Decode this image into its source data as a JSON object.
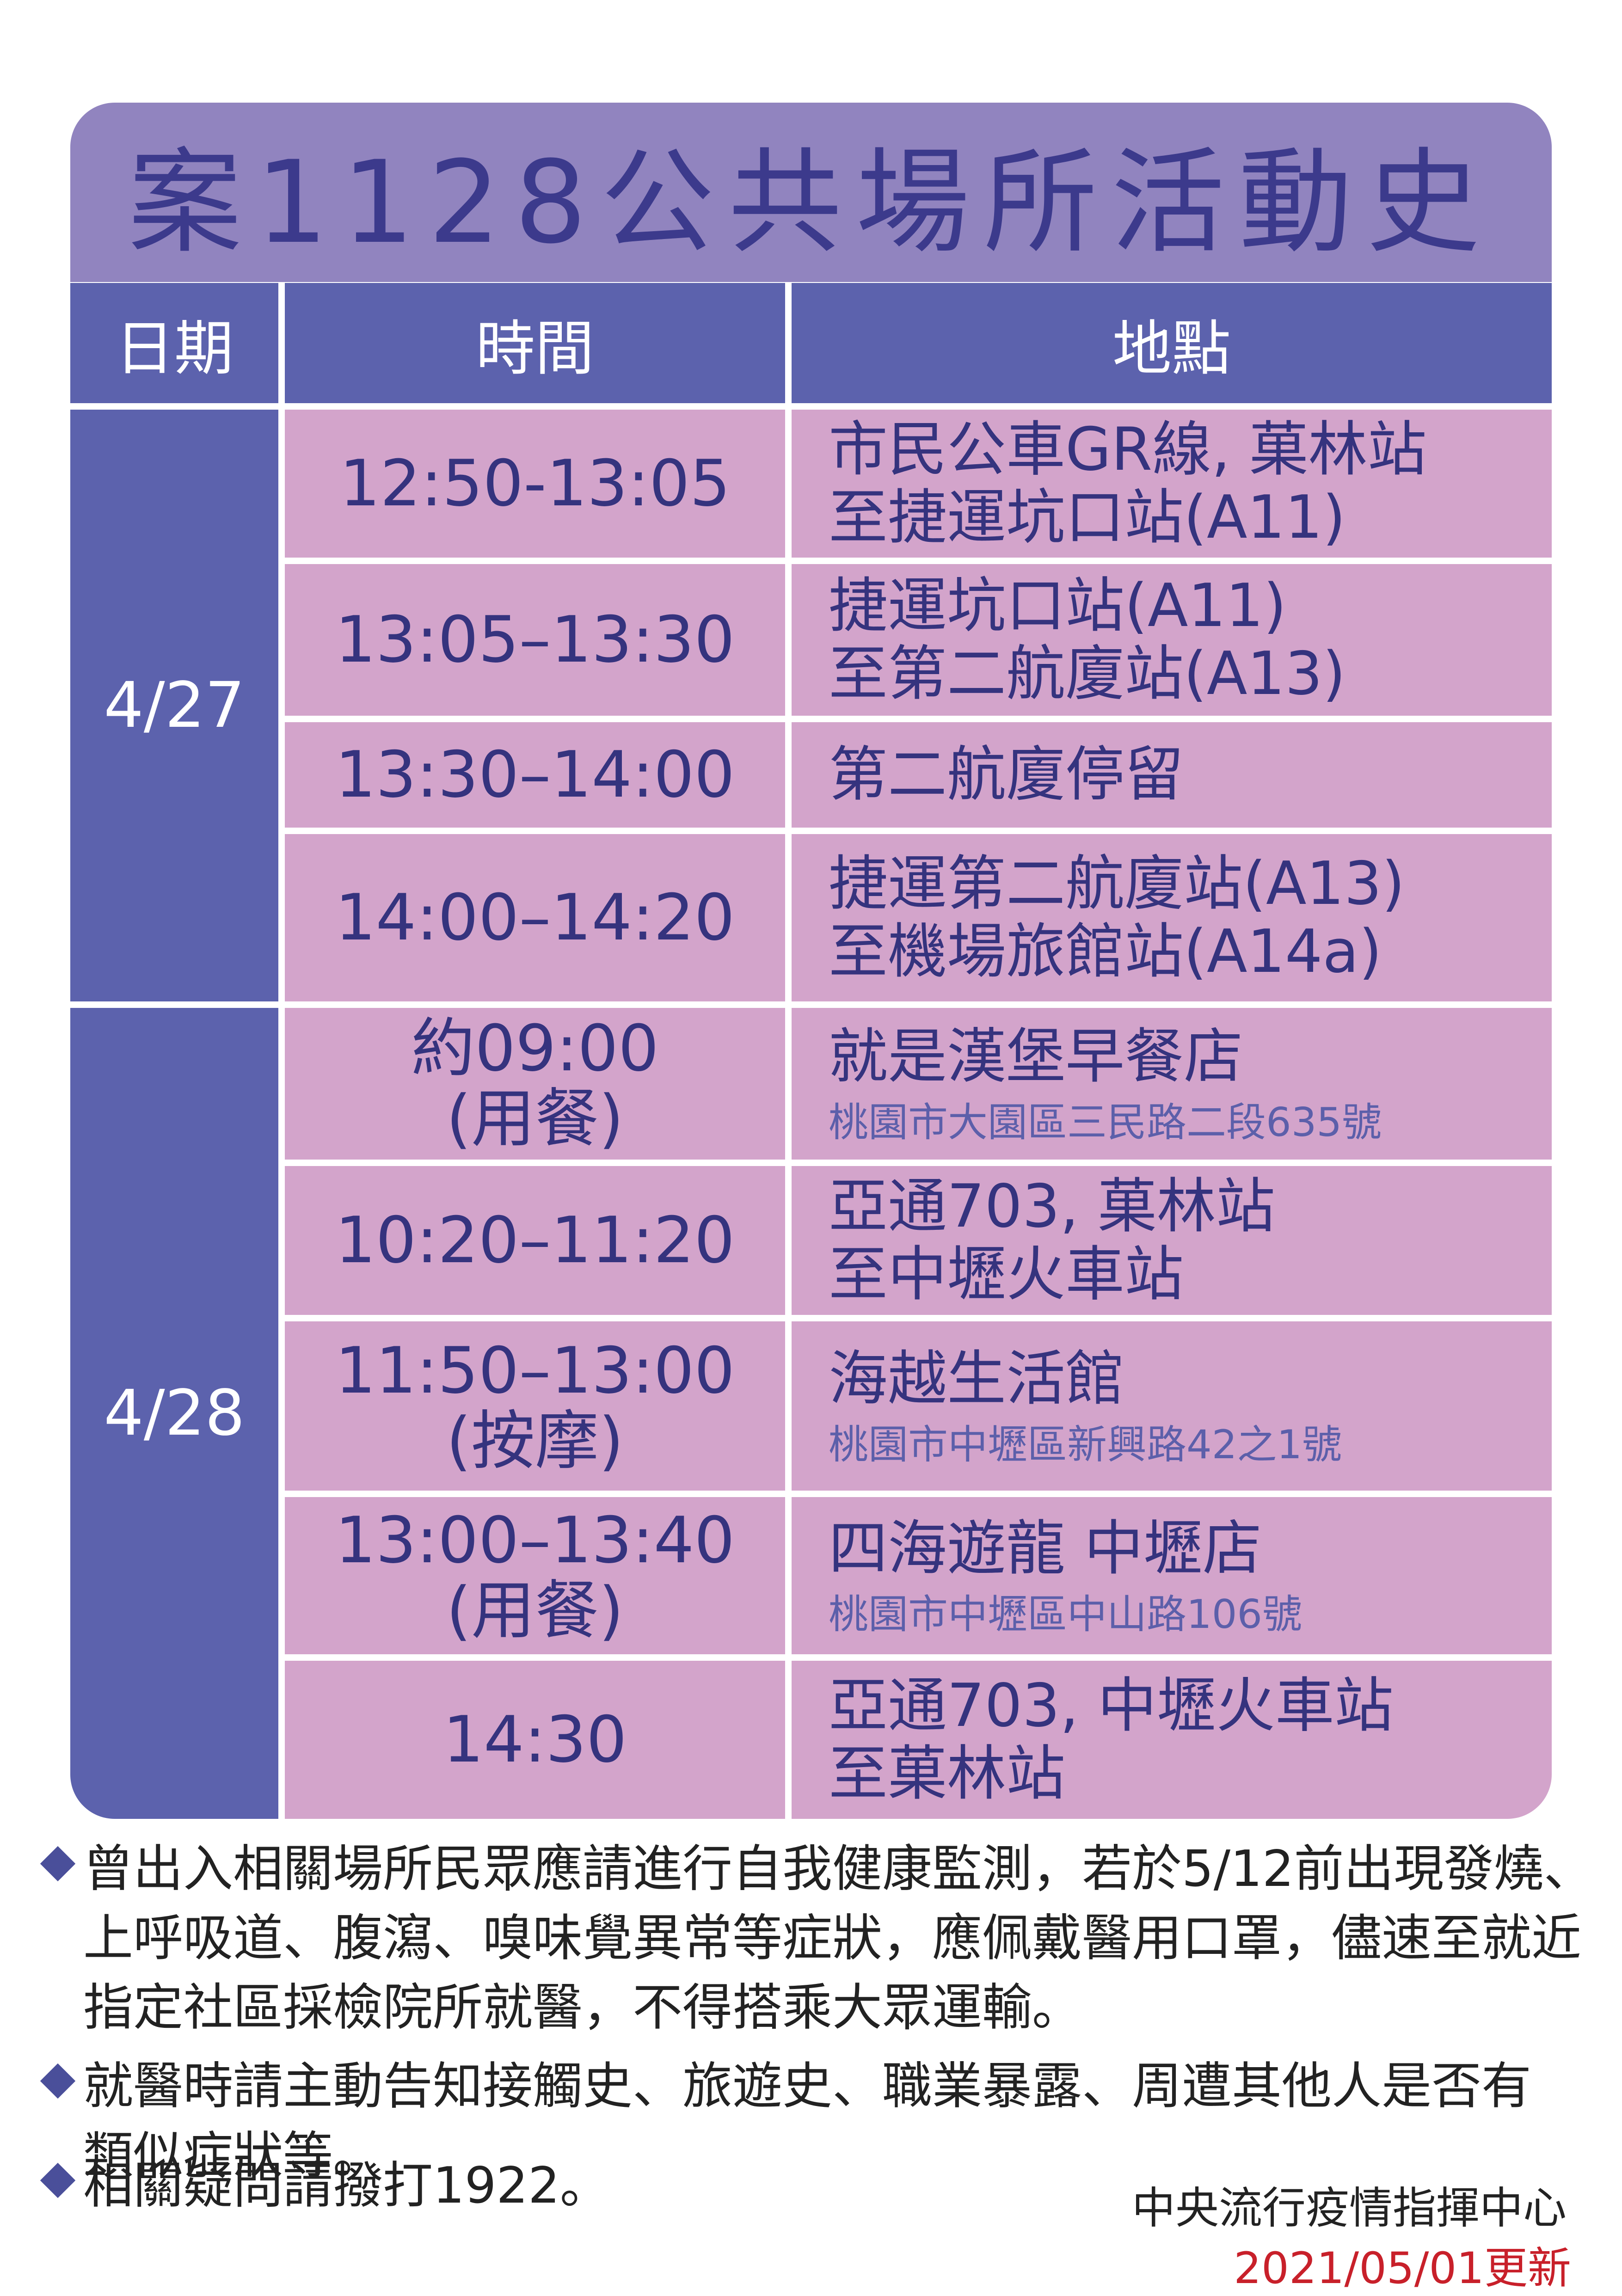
{
  "title": "案1128公共場所活動史",
  "headers": {
    "date": "日期",
    "time": "時間",
    "place": "地點"
  },
  "dates": [
    "4/27",
    "4/28"
  ],
  "rows": [
    {
      "time": "12:50-13:05",
      "place": "市民公車GR線, 菓林站\n至捷運坑口站(A11)",
      "address": ""
    },
    {
      "time": "13:05–13:30",
      "place": "捷運坑口站(A11)\n至第二航廈站(A13)",
      "address": ""
    },
    {
      "time": "13:30–14:00",
      "place": "第二航廈停留",
      "address": ""
    },
    {
      "time": "14:00–14:20",
      "place": "捷運第二航廈站(A13)\n至機場旅館站(A14a)",
      "address": ""
    },
    {
      "time": "約09:00\n(用餐)",
      "place": "就是漢堡早餐店",
      "address": "桃園市大園區三民路二段635號"
    },
    {
      "time": "10:20–11:20",
      "place": "亞通703, 菓林站\n至中壢火車站",
      "address": ""
    },
    {
      "time": "11:50–13:00\n(按摩)",
      "place": "海越生活館",
      "address": "桃園市中壢區新興路42之1號"
    },
    {
      "time": "13:00–13:40\n(用餐)",
      "place": "四海遊龍 中壢店",
      "address": "桃園市中壢區中山路106號"
    },
    {
      "time": "14:30",
      "place": "亞通703, 中壢火車站\n至菓林站",
      "address": ""
    }
  ],
  "notes": [
    "曾出入相關場所民眾應請進行自我健康監測，若於5/12前出現發燒、\n上呼吸道、腹瀉、嗅味覺異常等症狀，應佩戴醫用口罩，儘速至就近\n指定社區採檢院所就醫，不得搭乘大眾運輸。",
    "就醫時請主動告知接觸史、旅遊史、職業暴露、周遭其他人是否有\n類似症狀等。",
    "相關疑問請撥打1922。"
  ],
  "footer": {
    "agency": "中央流行疫情指揮中心",
    "updated": "2021/05/01更新"
  },
  "colors": {
    "title_bg": "#9184bf",
    "title_text": "#3c3a8c",
    "header_bg": "#5c62ad",
    "row_bg": "#d3a4cb",
    "text_dark": "#35337e",
    "updated_text": "#c8202a"
  }
}
